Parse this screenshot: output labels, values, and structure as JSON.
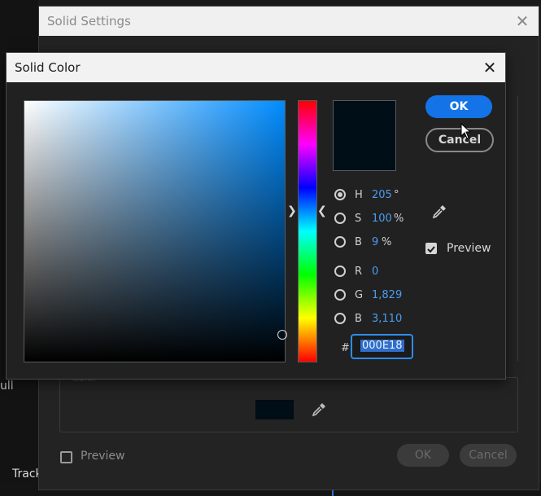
{
  "background": {
    "partial_label": "ull",
    "track_label": "Track"
  },
  "solid_settings": {
    "title": "Solid Settings",
    "close_icon": "close-icon",
    "color_section_label": "Color",
    "swatch_color": "#000e18",
    "preview_label": "Preview",
    "preview_checked": false,
    "ok_label": "OK",
    "cancel_label": "Cancel"
  },
  "solid_color": {
    "title": "Solid Color",
    "close_icon": "close-icon",
    "current_color": "#000e18",
    "hsb": [
      {
        "label": "H",
        "value": "205",
        "unit": "°",
        "selected": true
      },
      {
        "label": "S",
        "value": "100",
        "unit": "%",
        "selected": false
      },
      {
        "label": "B",
        "value": "9",
        "unit": "%",
        "selected": false
      }
    ],
    "rgb": [
      {
        "label": "R",
        "value": "0",
        "selected": false
      },
      {
        "label": "G",
        "value": "1,829",
        "selected": false
      },
      {
        "label": "B",
        "value": "3,110",
        "selected": false
      }
    ],
    "hex_symbol": "#",
    "hex_value": "000E18",
    "ok_label": "OK",
    "cancel_label": "Cancel",
    "preview_label": "Preview",
    "preview_checked": true,
    "accent_color": "#1473e6",
    "value_color": "#4a9cf2"
  }
}
